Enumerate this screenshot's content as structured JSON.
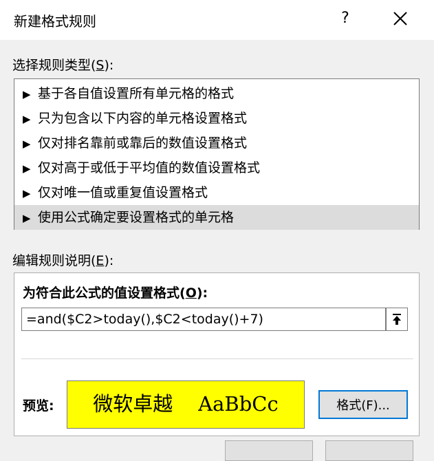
{
  "window": {
    "title": "新建格式规则",
    "help_label": "?",
    "close_icon": "close-icon"
  },
  "rule_type": {
    "label_prefix": "选择规则类型(",
    "label_key": "S",
    "label_suffix": "):",
    "items": [
      {
        "label": "基于各自值设置所有单元格的格式",
        "selected": false
      },
      {
        "label": "只为包含以下内容的单元格设置格式",
        "selected": false
      },
      {
        "label": "仅对排名靠前或靠后的数值设置格式",
        "selected": false
      },
      {
        "label": "仅对高于或低于平均值的数值设置格式",
        "selected": false
      },
      {
        "label": "仅对唯一值或重复值设置格式",
        "selected": false
      },
      {
        "label": "使用公式确定要设置格式的单元格",
        "selected": true
      }
    ],
    "arrow_glyph": "▶"
  },
  "edit_rule": {
    "label_prefix": "编辑规则说明(",
    "label_key": "E",
    "label_suffix": "):",
    "formula_label_prefix": "为符合此公式的值设置格式(",
    "formula_label_key": "O",
    "formula_label_suffix": "):",
    "formula_value": "=and($C2>today(),$C2<today()+7)",
    "collapse_icon": "collapse-dialog-icon",
    "preview_label": "预览:",
    "preview_text": "微软卓越    AaBbCc",
    "preview_bg": "#ffff00",
    "format_button_label": "格式(F)..."
  },
  "colors": {
    "accent": "#0078d7",
    "selected_row": "#dcdcdc"
  }
}
